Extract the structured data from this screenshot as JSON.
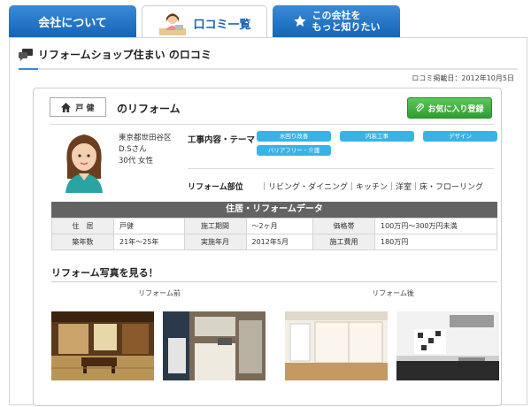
{
  "tabs": [
    {
      "label": "会社について"
    },
    {
      "label": "口コミ一覧"
    },
    {
      "label_line1": "この会社を",
      "label_line2": "もっと知りたい"
    }
  ],
  "heading": {
    "title": "リフォームショップ住まい のロコミ"
  },
  "post_date": "ロコミ掲載日：2012年10月5日",
  "card": {
    "house_type": "戸 健",
    "reform_title": "のリフォーム",
    "favorite_button": "お気に入り登録",
    "user": {
      "area": "東京都世田谷区",
      "name": "D.Sさん",
      "age_gender": "30代 女性"
    },
    "work_label": "工事内容・テーマ",
    "tags": [
      "水回り改善",
      "内装工事",
      "デザイン",
      "バリアフリー・介護"
    ],
    "rooms_label": "リフォーム部位",
    "rooms_value": "｜リビング・ダイニング｜キッチン｜洋室｜床・フローリング"
  },
  "data_table": {
    "header": "住居・リフォームデータ",
    "rows": [
      {
        "k1": "住　居",
        "v1": "戸健",
        "k2": "施工期間",
        "v2": "〜2ヶ月",
        "k3": "価格帯",
        "v3": "100万円〜300万円未満"
      },
      {
        "k1": "築年数",
        "v1": "21年〜25年",
        "k2": "実施年月",
        "v2": "2012年5月",
        "k3": "施工費用",
        "v3": "180万円"
      }
    ]
  },
  "photos": {
    "title": "リフォーム写真を見る！",
    "before_label": "リフォーム前",
    "after_label": "リフォーム後"
  },
  "colors": {
    "tab_blue": "#1f6fc2",
    "tag_blue": "#39b3e6",
    "favorite_green": "#3aa63a",
    "table_header": "#636363"
  }
}
